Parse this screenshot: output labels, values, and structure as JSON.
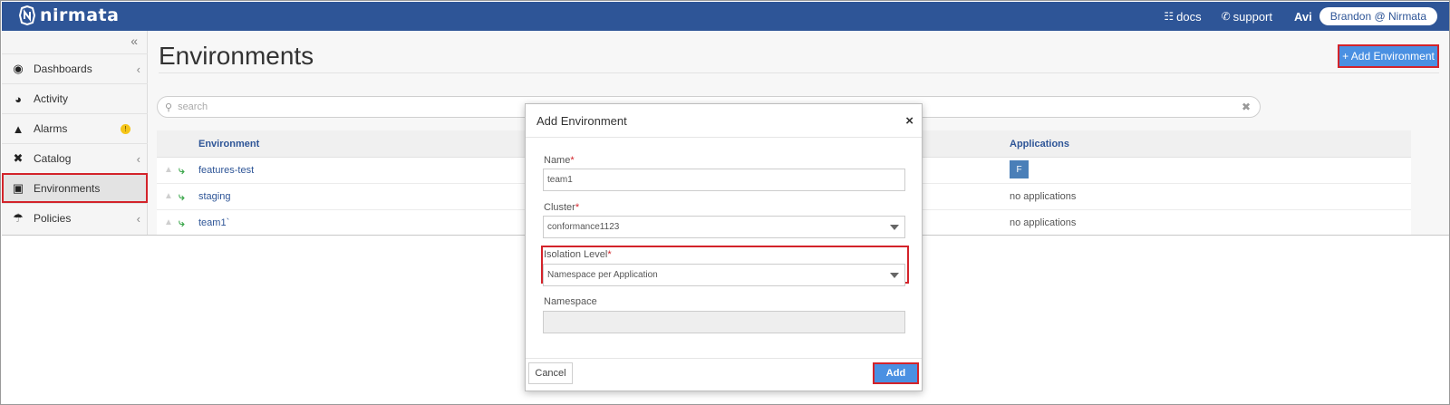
{
  "brand": {
    "name": "nirmata"
  },
  "topbar": {
    "docs_label": "docs",
    "support_label": "support",
    "user_short": "Avi",
    "user_full": "Brandon @ Nirmata"
  },
  "sidebar": {
    "collapse_icon": "«",
    "items": [
      {
        "label": "Dashboards",
        "icon": "dashboard-icon",
        "has_chevron": true
      },
      {
        "label": "Activity",
        "icon": "activity-icon",
        "has_chevron": false
      },
      {
        "label": "Alarms",
        "icon": "bell-icon",
        "badge": "!"
      },
      {
        "label": "Catalog",
        "icon": "tools-icon",
        "has_chevron": true
      },
      {
        "label": "Environments",
        "icon": "environments-icon",
        "active": true
      },
      {
        "label": "Policies",
        "icon": "umbrella-icon",
        "has_chevron": true
      }
    ]
  },
  "main": {
    "title": "Environments",
    "add_button_label": "+ Add Environment",
    "search": {
      "placeholder": "search"
    },
    "table": {
      "columns": {
        "environment": "Environment",
        "applications": "Applications"
      },
      "rows": [
        {
          "name": "features-test",
          "applications": "F"
        },
        {
          "name": "staging",
          "applications": "no applications"
        },
        {
          "name": "team1`",
          "applications": "no applications"
        }
      ]
    }
  },
  "modal": {
    "title": "Add Environment",
    "close_label": "×",
    "fields": {
      "name": {
        "label": "Name",
        "required_mark": "*",
        "value": "team1"
      },
      "cluster": {
        "label": "Cluster",
        "required_mark": "*",
        "value": "conformance1123"
      },
      "isolation": {
        "label": "Isolation Level",
        "required_mark": "*",
        "value": "Namespace per Application"
      },
      "namespace": {
        "label": "Namespace",
        "value": ""
      }
    },
    "cancel_label": "Cancel",
    "add_label": "Add"
  },
  "colors": {
    "topbar": "#2e5597",
    "accent_button": "#4a90e2",
    "highlight_outline": "#d3232a",
    "link": "#2e5597"
  }
}
